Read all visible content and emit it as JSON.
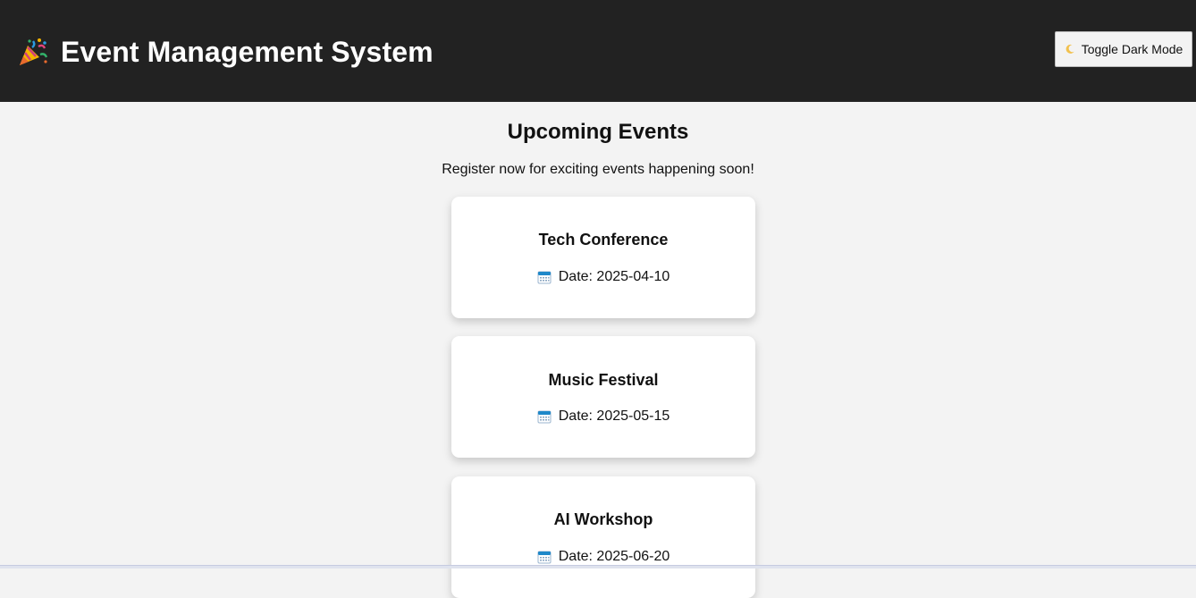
{
  "header": {
    "title": "Event Management System",
    "logo_icon": "party-popper-icon",
    "toggle_label": "Toggle Dark Mode",
    "toggle_icon": "moon-icon",
    "background": "#222222"
  },
  "main": {
    "heading": "Upcoming Events",
    "subtitle": "Register now for exciting events happening soon!",
    "background": "#f3f3f3"
  },
  "events": [
    {
      "name": "Tech Conference",
      "date_text": "Date: 2025-04-10",
      "icon": "calendar-icon"
    },
    {
      "name": "Music Festival",
      "date_text": "Date: 2025-05-15",
      "icon": "calendar-icon"
    },
    {
      "name": "AI Workshop",
      "date_text": "Date: 2025-06-20",
      "icon": "calendar-icon"
    }
  ]
}
